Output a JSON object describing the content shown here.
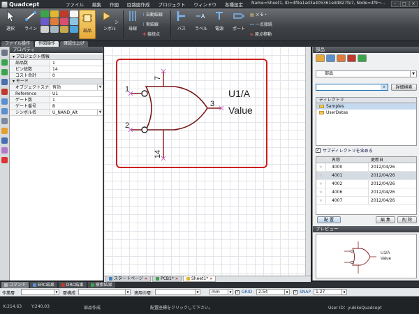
{
  "app": {
    "name": "Quadcept",
    "window_info": "Name=Sheet1, ID=4f9a1ad3a405361ed4827fe7, Node=4f9¬..."
  },
  "menu": [
    "ファイル",
    "編集",
    "作図",
    "回路図作成",
    "プロジェクト",
    "ウィンドウ",
    "各種設定"
  ],
  "ribbon": {
    "select": "選択",
    "line": "ライン",
    "part": "部品",
    "symbol": "シンボル",
    "bus_wire": "母線",
    "auto_wire": "自動結線",
    "real_wire": "実結線",
    "junction": "接続点",
    "bus": "バス",
    "label": "ラベル",
    "power": "電源",
    "port": "ポート",
    "memo": "メモ・",
    "single_wire": "一点接続",
    "move_origin": "原点移動"
  },
  "subtabs": [
    "ファイル操作",
    "作図操作",
    "確認仕上げ"
  ],
  "properties": {
    "title": "プロパティ",
    "section_project": "プロジェクト情報",
    "section_mode": "モード",
    "project_rows": [
      {
        "k": "部品数",
        "v": "1"
      },
      {
        "k": "ピン総数",
        "v": "14"
      },
      {
        "k": "コスト合計",
        "v": "0"
      }
    ],
    "mode_rows": [
      {
        "k": "オブジェクトスナ",
        "v": "有効",
        "dd": true
      },
      {
        "k": "Reference",
        "v": "U1",
        "dd": false
      },
      {
        "k": "ゲート数",
        "v": "1",
        "dd": false
      },
      {
        "k": "ゲート番号",
        "v": "B",
        "dd": false
      },
      {
        "k": "シンボル名",
        "v": "U_NAND_Alt",
        "dd": true
      }
    ]
  },
  "schematic": {
    "ref": "U1/A",
    "value": "Value",
    "pins": [
      "7",
      "1",
      "2",
      "3",
      "14"
    ]
  },
  "doc_tabs": [
    "スタートページ",
    "PCB1*",
    "Sheet1*"
  ],
  "parts_panel": {
    "title": "部品",
    "select_value": "部品",
    "detail_search": "詳細検索",
    "directory_title": "ディレクトリ",
    "directories": [
      "Samples",
      "UserDatas"
    ],
    "include_sub": "サブディレクトリを含める",
    "table_headers": [
      "名称",
      "更新日"
    ],
    "rows": [
      {
        "name": "4000",
        "date": "2012/04/26"
      },
      {
        "name": "4001",
        "date": "2012/04/26"
      },
      {
        "name": "4002",
        "date": "2012/04/26"
      },
      {
        "name": "4006",
        "date": "2012/04/26"
      },
      {
        "name": "4007",
        "date": "2012/04/26"
      }
    ],
    "place_btn": "配 置",
    "edit_btn": "編 集",
    "delete_btn": "削 除",
    "preview_title": "プレビュー"
  },
  "bottom_tabs": [
    "コマンド",
    "ERC結果",
    "DRC結果",
    "検索結果"
  ],
  "cmdbar": {
    "op_label": "作業層",
    "arrange_label": "層構成",
    "apply_label": "適用の層：",
    "unit": "mm",
    "grid_label": "GRID",
    "grid_value": "2.54",
    "snap_label": "SNAP",
    "snap_value": "1.27"
  },
  "status": {
    "x": "X:214.63",
    "y": "Y:240.03",
    "mode": "部品作成",
    "hint": "配置座標をクリックして下さい。",
    "user": "User ID：yukikoQuadcept"
  },
  "colors": {
    "accent": "#e8a93a",
    "outline": "#cc1f1f",
    "symbol": "#7a1616",
    "pin": "#8a1a1a"
  }
}
